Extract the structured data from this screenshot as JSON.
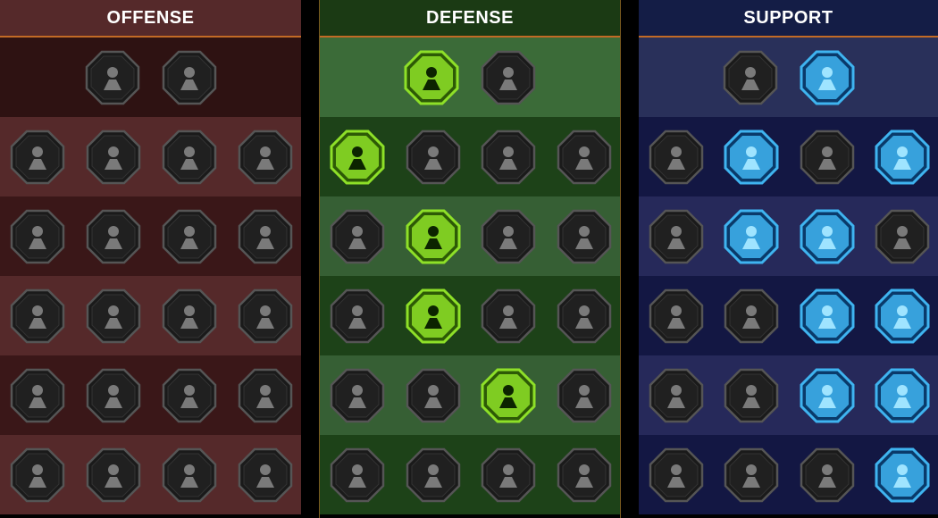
{
  "colors": {
    "offense_accent": "#55292a",
    "defense_accent": "#8ee028",
    "support_accent": "#3fb4f0",
    "inactive_fill": "#1b1b1b"
  },
  "trees": [
    {
      "id": "offense",
      "title": "OFFENSE",
      "rows": [
        [
          {
            "icon": "crossed-swords-icon",
            "active": false
          },
          {
            "icon": "triple-blades-icon",
            "active": false
          }
        ],
        [
          {
            "icon": "horned-warrior-icon",
            "active": false
          },
          {
            "icon": "slashing-speed-icon",
            "active": false
          },
          {
            "icon": "shield-break-icon",
            "active": false
          },
          {
            "icon": "broken-heart-icon",
            "active": false
          }
        ],
        [
          {
            "icon": "fist-strike-icon",
            "active": false
          },
          {
            "icon": "demon-maw-icon",
            "active": false
          },
          {
            "icon": "skull-wind-icon",
            "active": false
          },
          {
            "icon": "claw-hand-icon",
            "active": false
          }
        ],
        [
          {
            "icon": "bleeding-drop-icon",
            "active": false
          },
          {
            "icon": "gauntlet-fist-icon",
            "active": false
          },
          {
            "icon": "axe-strike-icon",
            "active": false
          },
          {
            "icon": "lightning-chain-icon",
            "active": false
          }
        ],
        [
          {
            "icon": "eye-slash-icon",
            "active": false
          },
          {
            "icon": "skull-mouse-icon",
            "active": false
          },
          {
            "icon": "dagger-circle-icon",
            "active": false
          },
          {
            "icon": "flexing-brute-icon",
            "active": false
          }
        ],
        [
          {
            "icon": "sword-sparkle-icon",
            "active": false
          },
          {
            "icon": "knight-helm-icon",
            "active": false
          },
          {
            "icon": "horned-demon-icon",
            "active": false
          },
          {
            "icon": "flaming-skull-icon",
            "active": false
          }
        ]
      ]
    },
    {
      "id": "defense",
      "title": "DEFENSE",
      "rows": [
        [
          {
            "icon": "brick-wall-icon",
            "active": true
          },
          {
            "icon": "raised-fist-icon",
            "active": false
          }
        ],
        [
          {
            "icon": "chevron-shield-icon",
            "active": true
          },
          {
            "icon": "anatomical-heart-icon",
            "active": false
          },
          {
            "icon": "armored-torso-icon",
            "active": false
          },
          {
            "icon": "crossed-blades-icon",
            "active": false
          }
        ],
        [
          {
            "icon": "block-stance-icon",
            "active": false
          },
          {
            "icon": "knight-shield-icon",
            "active": true
          },
          {
            "icon": "heart-skull-icon",
            "active": false
          },
          {
            "icon": "hooded-figure-icon",
            "active": false
          }
        ],
        [
          {
            "icon": "crowd-rally-icon",
            "active": false
          },
          {
            "icon": "hourglass-burst-icon",
            "active": true
          },
          {
            "icon": "open-palm-icon",
            "active": false
          },
          {
            "icon": "bull-head-icon",
            "active": false
          }
        ],
        [
          {
            "icon": "dash-runner-icon",
            "active": false
          },
          {
            "icon": "triple-spikes-icon",
            "active": false
          },
          {
            "icon": "sun-skull-icon",
            "active": true
          },
          {
            "icon": "swirl-grab-icon",
            "active": false
          }
        ],
        [
          {
            "icon": "armored-beast-icon",
            "active": false
          },
          {
            "icon": "winged-shield-icon",
            "active": false
          },
          {
            "icon": "bearded-king-icon",
            "active": false
          },
          {
            "icon": "strongman-icon",
            "active": false
          }
        ]
      ]
    },
    {
      "id": "support",
      "title": "SUPPORT",
      "rows": [
        [
          {
            "icon": "heart-plus-icon",
            "active": false
          },
          {
            "icon": "spiral-vortex-icon",
            "active": true
          }
        ],
        [
          {
            "icon": "praying-hands-icon",
            "active": false
          },
          {
            "icon": "aura-shield-icon",
            "active": true
          },
          {
            "icon": "poison-skull-icon",
            "active": false
          },
          {
            "icon": "sweeping-hand-icon",
            "active": true
          }
        ],
        [
          {
            "icon": "sparkle-figure-icon",
            "active": false
          },
          {
            "icon": "lightning-bolt-icon",
            "active": true
          },
          {
            "icon": "shatter-icon",
            "active": true
          },
          {
            "icon": "shadow-duo-icon",
            "active": false
          }
        ],
        [
          {
            "icon": "heart-chain-icon",
            "active": false
          },
          {
            "icon": "comet-icon",
            "active": false
          },
          {
            "icon": "open-book-icon",
            "active": true
          },
          {
            "icon": "angry-eyes-icon",
            "active": true
          }
        ],
        [
          {
            "icon": "compass-star-icon",
            "active": false
          },
          {
            "icon": "running-boot-icon",
            "active": false
          },
          {
            "icon": "all-seeing-eye-icon",
            "active": true
          },
          {
            "icon": "voodoo-doll-icon",
            "active": true
          }
        ],
        [
          {
            "icon": "potion-flask-icon",
            "active": false
          },
          {
            "icon": "fanged-skull-icon",
            "active": false
          },
          {
            "icon": "grasping-hand-icon",
            "active": false
          },
          {
            "icon": "eagle-head-icon",
            "active": true
          }
        ]
      ]
    }
  ]
}
